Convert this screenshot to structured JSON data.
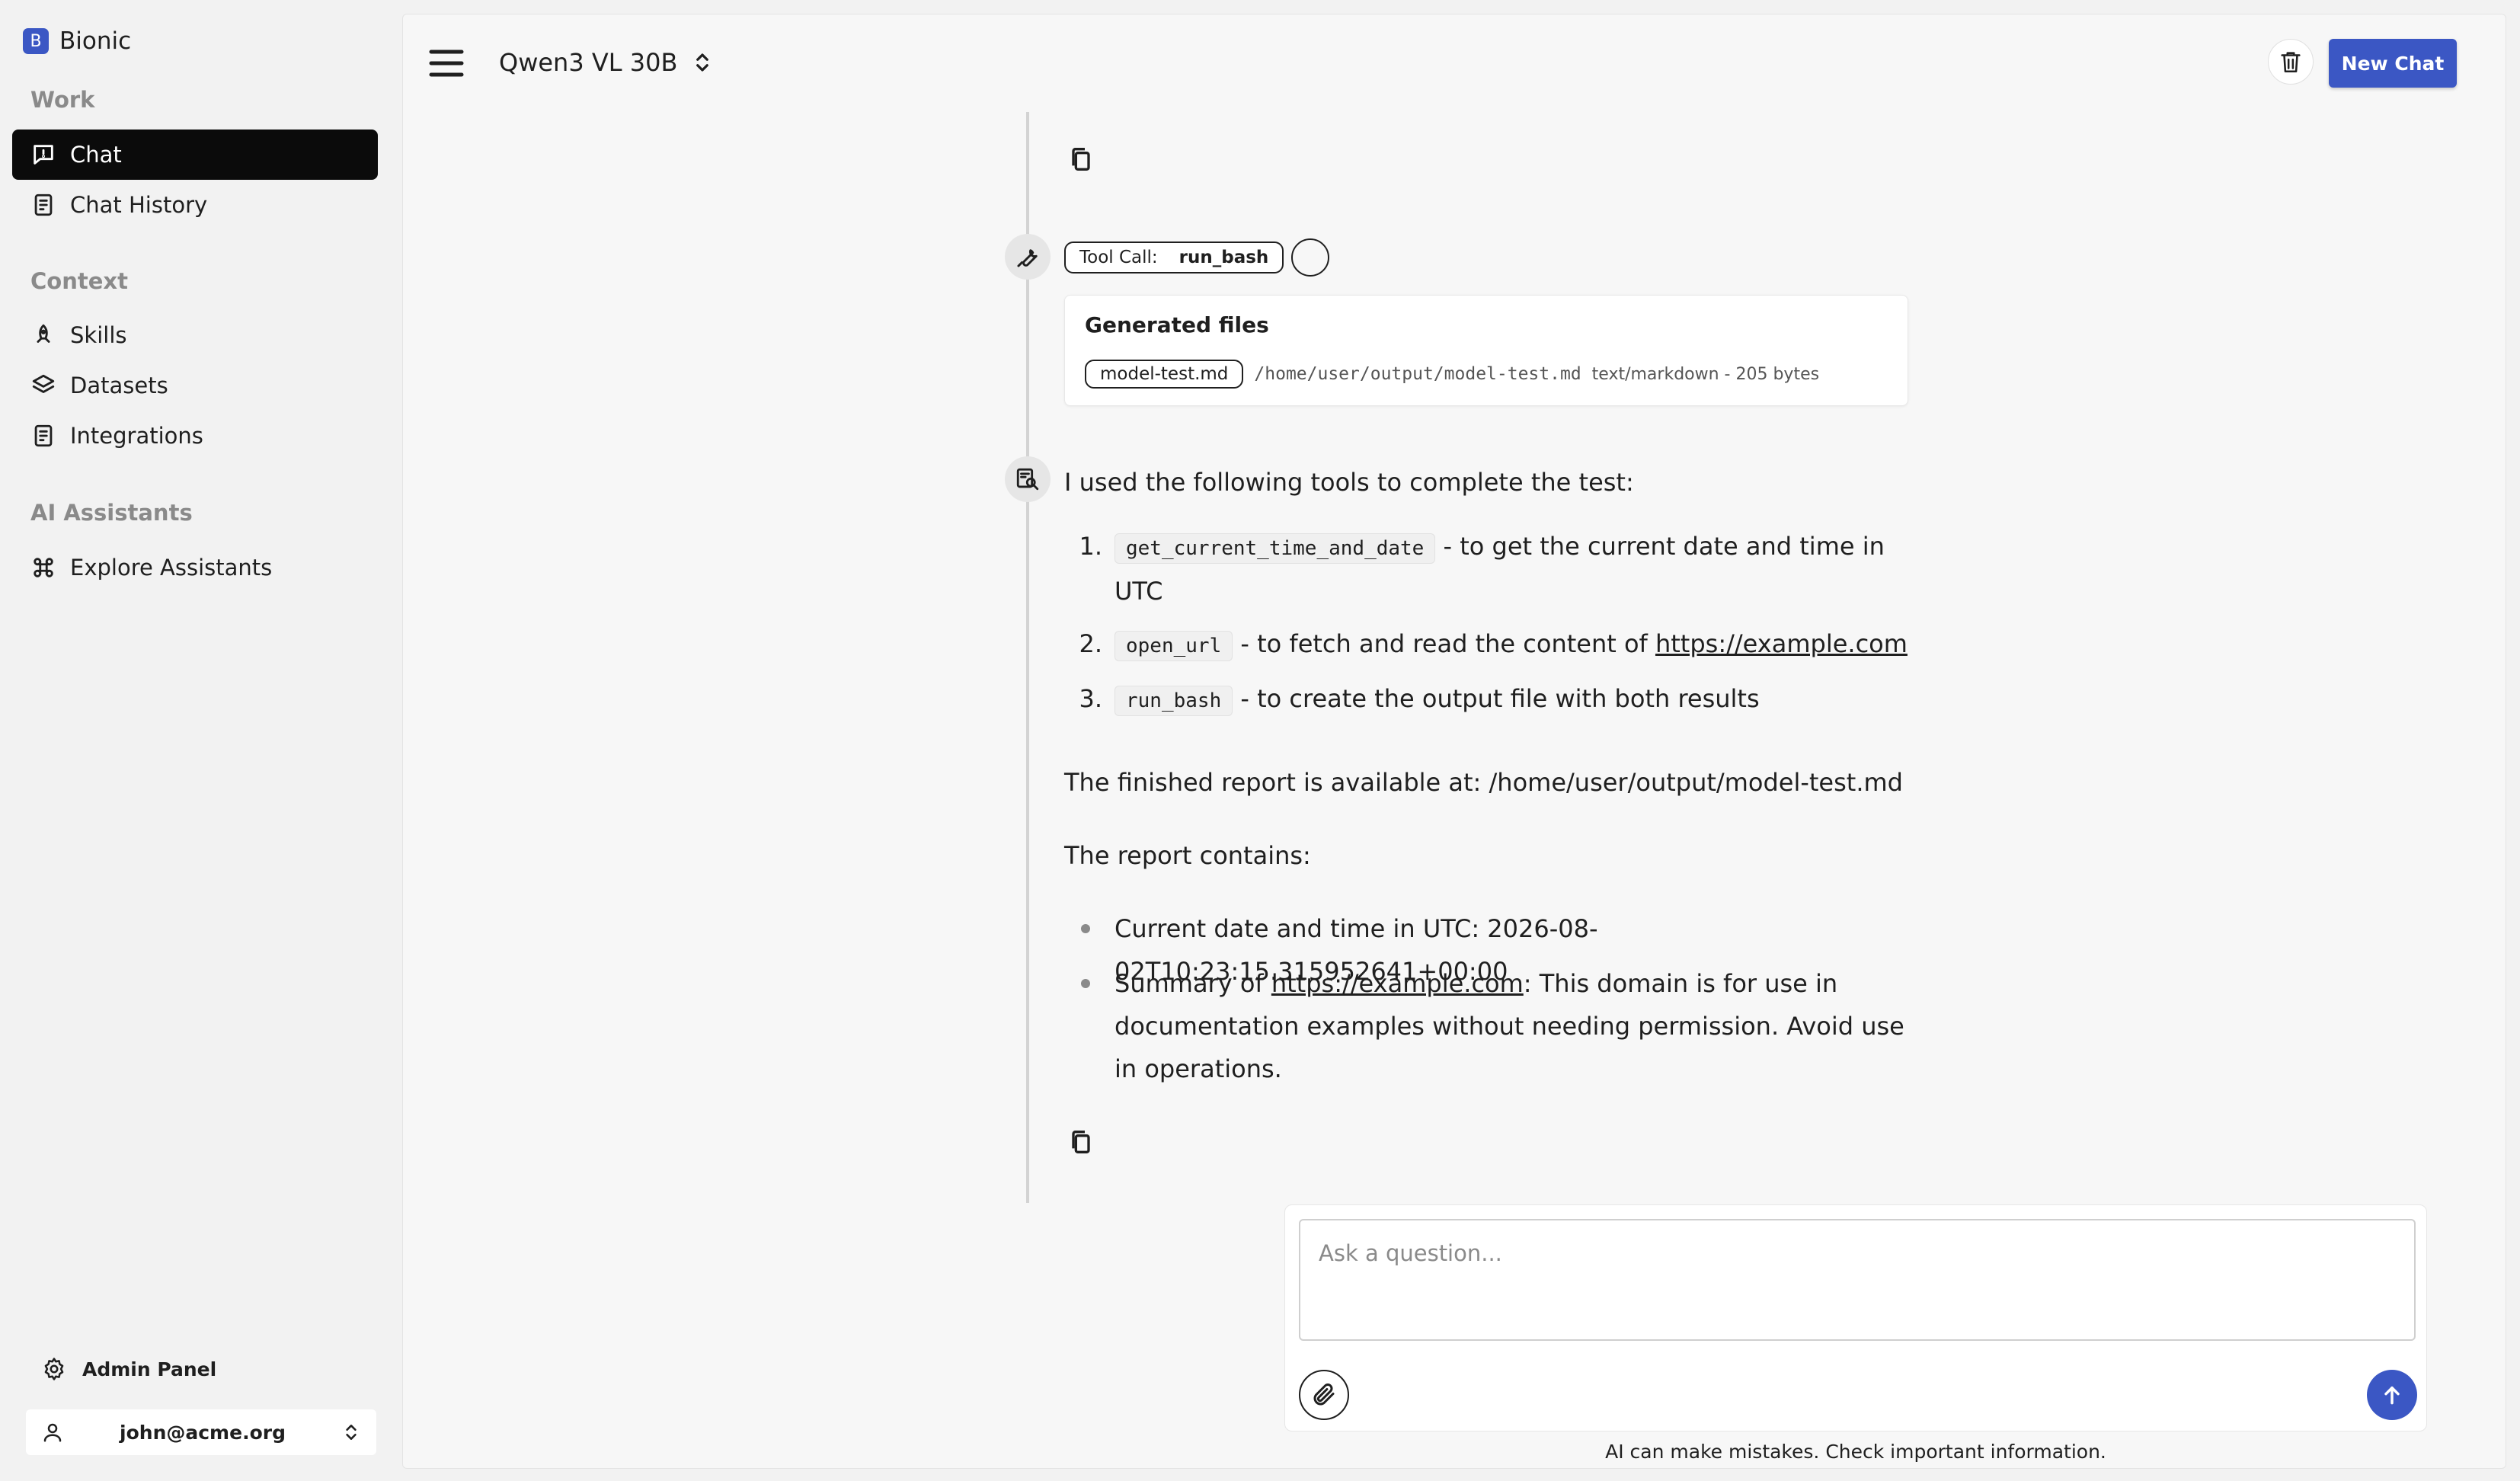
{
  "sidebar": {
    "brand_letter": "B",
    "brand_name": "Bionic",
    "sections": {
      "work": "Work",
      "context": "Context",
      "ai_assistants": "AI Assistants"
    },
    "items": {
      "chat": "Chat",
      "chat_history": "Chat History",
      "skills": "Skills",
      "datasets": "Datasets",
      "integrations": "Integrations",
      "explore_assistants": "Explore Assistants"
    },
    "admin_panel": "Admin Panel",
    "user_email": "john@acme.org"
  },
  "header": {
    "model_name": "Qwen3 VL 30B",
    "new_chat_label": "New Chat"
  },
  "conversation": {
    "tool_call_label": "Tool Call:",
    "tool_call_name": "run_bash",
    "generated_files_title": "Generated files",
    "file_chip": "model-test.md",
    "file_path": "/home/user/output/model-test.md",
    "file_meta": "text/markdown - 205 bytes",
    "intro": "I used the following tools to complete the test:",
    "tools": [
      {
        "num": "1.",
        "code": "get_current_time_and_date",
        "text": " - to get the current date and time in UTC"
      },
      {
        "num": "2.",
        "code": "open_url",
        "text_before": " - to fetch and read the content of ",
        "link": "https://example.com"
      },
      {
        "num": "3.",
        "code": "run_bash",
        "text": " - to create the output file with both results"
      }
    ],
    "report_location": "The finished report is available at: /home/user/output/model-test.md",
    "report_contains": "The report contains:",
    "bullets": {
      "datetime": "Current date and time in UTC: 2026-08-02T10:23:15.315952641+00:00",
      "summary_prefix": "Summary of ",
      "summary_link": "https://example.com",
      "summary_text": ": This domain is for use in documentation examples without needing permission. Avoid use in operations."
    }
  },
  "composer": {
    "placeholder": "Ask a question...",
    "disclaimer": "AI can make mistakes. Check important information."
  },
  "colors": {
    "accent": "#3b57c4",
    "active_nav": "#0b0b0b",
    "background": "#f2f2f2"
  }
}
